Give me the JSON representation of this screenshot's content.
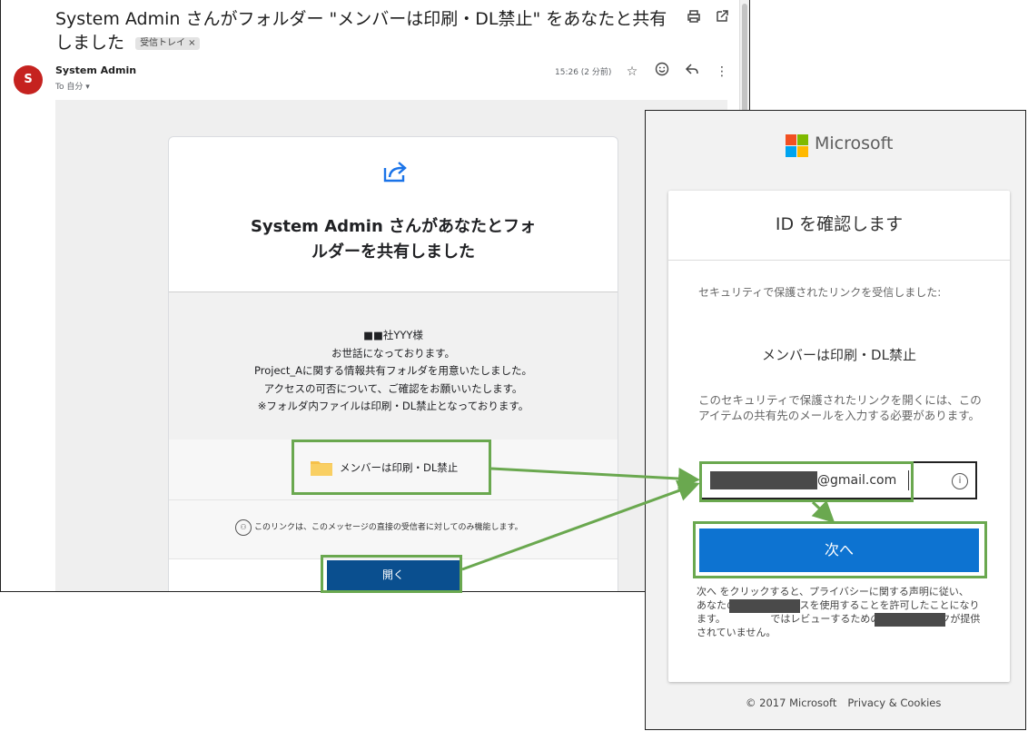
{
  "gmail": {
    "subject": "System Admin さんがフォルダー \"メンバーは印刷・DL禁止\" をあなたと共有しました",
    "label": "受信トレイ",
    "label_close": "×",
    "print_icon": "print-icon",
    "open_new_icon": "open-in-new-icon",
    "avatar_letter": "S",
    "sender": "System Admin",
    "to": "To 自分",
    "time": "15:26 (2 分前)",
    "card": {
      "title": "System Admin さんがあなたとフォルダーを共有しました",
      "message_lines": [
        "■■社YYY様",
        "お世話になっております。",
        "Project_Aに関する情報共有フォルダを用意いたしました。",
        "アクセスの可否について、ご確認をお願いいたします。",
        "※フォルダ内ファイルは印刷・DL禁止となっております。"
      ],
      "folder_name": "メンバーは印刷・DL禁止",
      "note": "このリンクは、このメッセージの直接の受信者に対してのみ機能します。",
      "open_button": "開く"
    }
  },
  "ms": {
    "brand": "Microsoft",
    "heading": "ID を確認します",
    "intro": "セキュリティで保護されたリンクを受信しました:",
    "item": "メンバーは印刷・DL禁止",
    "instruction": "このセキュリティで保護されたリンクを開くには、このアイテムの共有先のメールを入力する必要があります。",
    "email_suffix": "@gmail.com",
    "next_button": "次へ",
    "legal": "次へ をクリックすると、プライバシーに関する声明に従い、　　　　　あなたのメール アドレスを使用することを許可したことになります。　　　　　ではレビューするための条件へのリンクが提供されていません。",
    "copyright": "© 2017 Microsoft",
    "privacy": "Privacy & Cookies",
    "colors": {
      "red": "#f25022",
      "green": "#7fba00",
      "blue": "#00a4ef",
      "yellow": "#ffb900",
      "button": "#0d73d1",
      "highlight": "#6aa84f"
    }
  }
}
